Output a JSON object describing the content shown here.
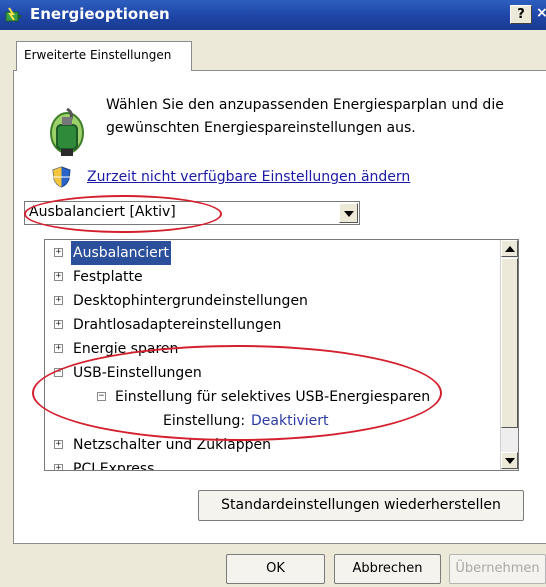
{
  "window": {
    "title": "Energieoptionen",
    "help_label": "?",
    "close_label": "×"
  },
  "tab": {
    "label": "Erweiterte Einstellungen"
  },
  "intro": {
    "text": "Wählen Sie den anzupassenden Energiesparplan und die gewünschten Energiespareinstellungen aus."
  },
  "link": {
    "text": "Zurzeit nicht verfügbare Einstellungen ändern"
  },
  "plan_select": {
    "value": "Ausbalanciert [Aktiv]"
  },
  "tree": {
    "items": [
      {
        "toggle": "+",
        "label": "Ausbalanciert",
        "selected": true
      },
      {
        "toggle": "+",
        "label": "Festplatte"
      },
      {
        "toggle": "+",
        "label": "Desktophintergrundeinstellungen"
      },
      {
        "toggle": "+",
        "label": "Drahtlosadaptereinstellungen"
      },
      {
        "toggle": "+",
        "label": "Energie sparen"
      },
      {
        "toggle": "−",
        "label": "USB-Einstellungen"
      },
      {
        "toggle": "−",
        "label": "Einstellung für selektives USB-Energiesparen"
      },
      {
        "label": "Einstellung:",
        "value": "Deaktiviert"
      },
      {
        "toggle": "+",
        "label": "Netzschalter und Zuklappen"
      },
      {
        "toggle": "+",
        "label": "PCI Express"
      }
    ]
  },
  "buttons": {
    "restore": "Standardeinstellungen wiederherstellen",
    "ok": "OK",
    "cancel": "Abbrechen",
    "apply": "Übernehmen"
  },
  "colors": {
    "titlebar": "#1e45a6",
    "selection": "#2b4f9a",
    "link": "#1a1aa6",
    "highlight_ellipse": "#d4202e"
  },
  "icons": {
    "app": "power-options-icon",
    "plan": "battery-plug-icon",
    "shield": "uac-shield-icon"
  }
}
